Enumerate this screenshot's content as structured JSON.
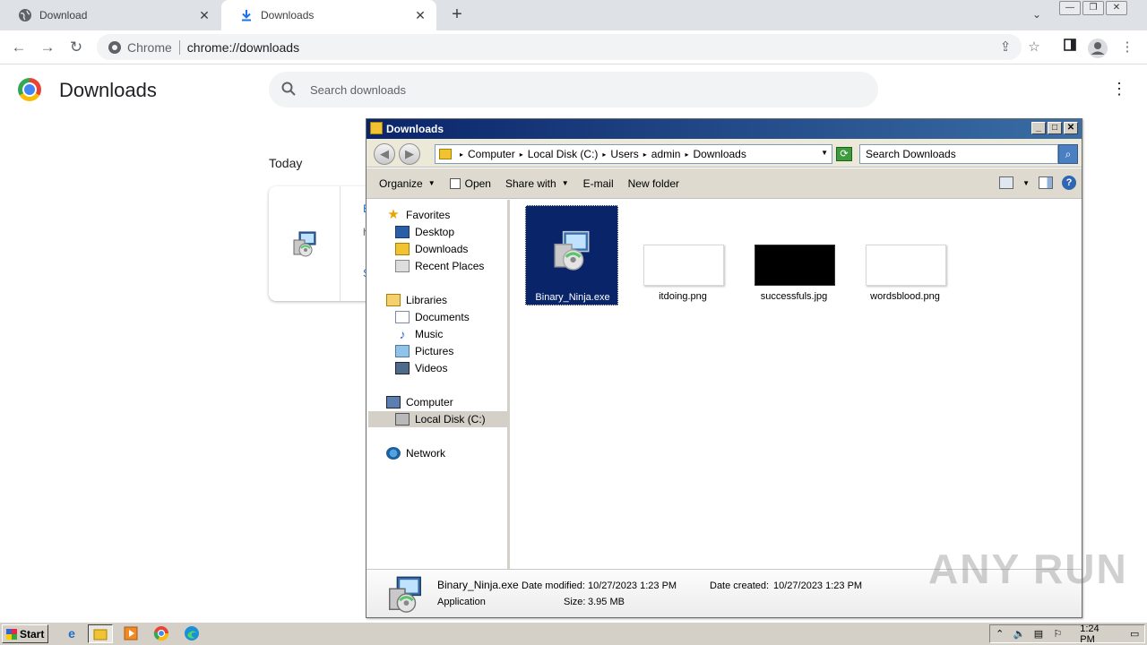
{
  "browser": {
    "tabs": [
      {
        "label": "Download",
        "close": "✕"
      },
      {
        "label": "Downloads",
        "close": "✕"
      }
    ],
    "new_tab": "+",
    "tab_search": "⌄",
    "window_controls": [
      "—",
      "❐",
      "✕"
    ],
    "omnibox": {
      "chip": "Chrome",
      "url": "chrome://downloads"
    }
  },
  "downloads_page": {
    "title": "Downloads",
    "search_placeholder": "Search downloads",
    "section": "Today",
    "card_fragments": [
      "B",
      "h",
      "S"
    ]
  },
  "explorer": {
    "title": "Downloads",
    "breadcrumbs": [
      "Computer",
      "Local Disk (C:)",
      "Users",
      "admin",
      "Downloads"
    ],
    "search_placeholder": "Search Downloads",
    "commands": [
      "Organize",
      "Open",
      "Share with",
      "E-mail",
      "New folder"
    ],
    "nav": {
      "favorites": {
        "label": "Favorites",
        "items": [
          "Desktop",
          "Downloads",
          "Recent Places"
        ]
      },
      "libraries": {
        "label": "Libraries",
        "items": [
          "Documents",
          "Music",
          "Pictures",
          "Videos"
        ]
      },
      "computer": {
        "label": "Computer",
        "items": [
          "Local Disk (C:)"
        ]
      },
      "network": {
        "label": "Network"
      }
    },
    "files": [
      {
        "name": "Binary_Ninja.exe",
        "type": "exe",
        "selected": true
      },
      {
        "name": "itdoing.png",
        "type": "png-white"
      },
      {
        "name": "successfuls.jpg",
        "type": "jpg-black"
      },
      {
        "name": "wordsblood.png",
        "type": "png-white"
      }
    ],
    "status": {
      "file_name": "Binary_Ninja.exe",
      "file_type": "Application",
      "modified_label": "Date modified:",
      "modified_value": "10/27/2023 1:23 PM",
      "size_label": "Size:",
      "size_value": "3.95 MB",
      "created_label": "Date created:",
      "created_value": "10/27/2023 1:23 PM"
    }
  },
  "taskbar": {
    "start_label": "Start",
    "apps": [
      "ie-icon",
      "explorer-icon",
      "media-player-icon",
      "chrome-icon",
      "edge-icon"
    ],
    "clock": "1:24 PM"
  },
  "watermark": "ANY RUN"
}
